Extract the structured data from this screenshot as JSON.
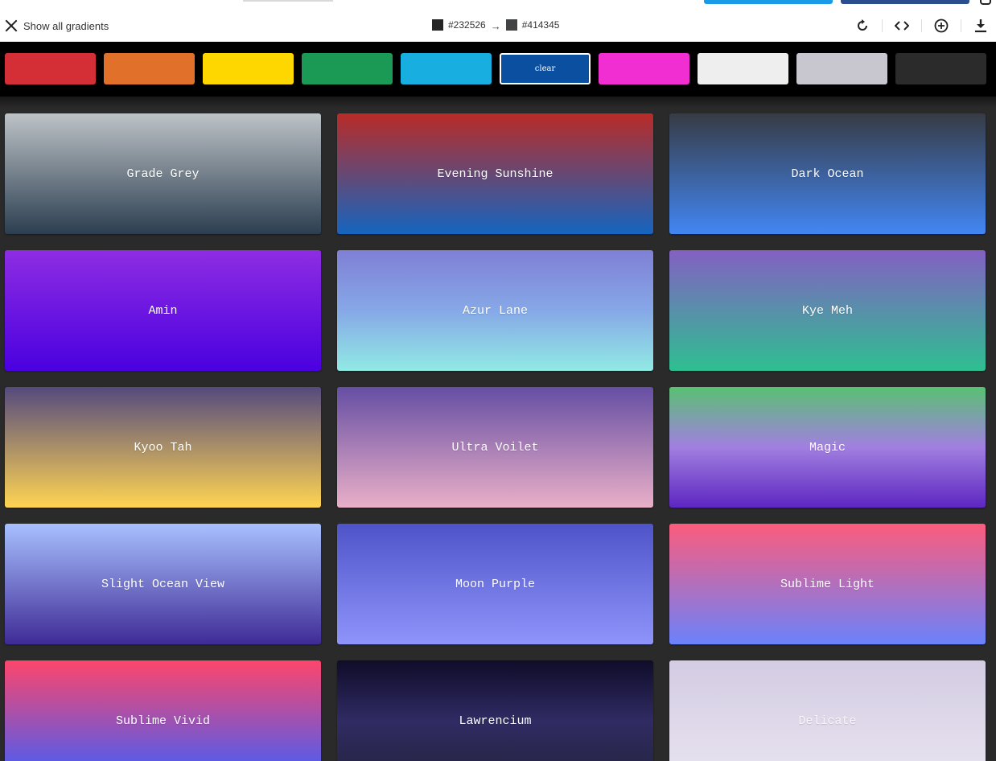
{
  "toolbar": {
    "show_all_label": "Show all gradients",
    "color_from": "#232526",
    "color_to": "#414345",
    "arrow": "→",
    "icons": [
      "close-icon",
      "rotate-icon",
      "code-icon",
      "add-icon",
      "download-icon"
    ]
  },
  "filters": [
    {
      "name": "red",
      "color": "#d42f36"
    },
    {
      "name": "orange",
      "color": "#e0702a"
    },
    {
      "name": "yellow",
      "color": "#ffd700"
    },
    {
      "name": "green",
      "color": "#1a9a55"
    },
    {
      "name": "cyan",
      "color": "#18aee0"
    },
    {
      "name": "blue",
      "color": "#0a4fa0",
      "label": "clear",
      "active": true
    },
    {
      "name": "pink",
      "color": "#f02ed2"
    },
    {
      "name": "white",
      "color": "#eeeeee"
    },
    {
      "name": "grey",
      "color": "#c8c7d0"
    },
    {
      "name": "black",
      "color": "#2b2b2b"
    }
  ],
  "gradients": [
    {
      "name": "Grade Grey",
      "from": "#bdc3c7",
      "to": "#2c3e50"
    },
    {
      "name": "Evening Sunshine",
      "from": "#b92b27",
      "to": "#1565c0"
    },
    {
      "name": "Dark Ocean",
      "from": "#373b44",
      "to": "#4286f4"
    },
    {
      "name": "Amin",
      "from": "#8e2de2",
      "to": "#4a00e0"
    },
    {
      "name": "Azur Lane",
      "from": "#7f7fd5",
      "to": "#91eae4",
      "mid": "#86a8e7"
    },
    {
      "name": "Kye Meh",
      "from": "#8360c3",
      "to": "#2ebf91"
    },
    {
      "name": "Kyoo Tah",
      "from": "#544a7d",
      "to": "#ffd452"
    },
    {
      "name": "Ultra Voilet",
      "from": "#654ea3",
      "to": "#eaafc8"
    },
    {
      "name": "Magic",
      "from": "#59c173",
      "to": "#5d26c1",
      "mid": "#a17fe0"
    },
    {
      "name": "Slight Ocean View",
      "from": "#a8c0ff",
      "to": "#3f2b96"
    },
    {
      "name": "Moon Purple",
      "from": "#4e54c8",
      "to": "#8f94fb"
    },
    {
      "name": "Sublime Light",
      "from": "#fc5c7d",
      "to": "#6a82fb"
    },
    {
      "name": "Sublime Vivid",
      "from": "#fc466b",
      "to": "#3f5efb"
    },
    {
      "name": "Lawrencium",
      "from": "#0f0c29",
      "to": "#24243e",
      "mid": "#302b63"
    },
    {
      "name": "Delicate",
      "from": "#d3cce3",
      "to": "#e9e4f0",
      "faint": true
    }
  ]
}
